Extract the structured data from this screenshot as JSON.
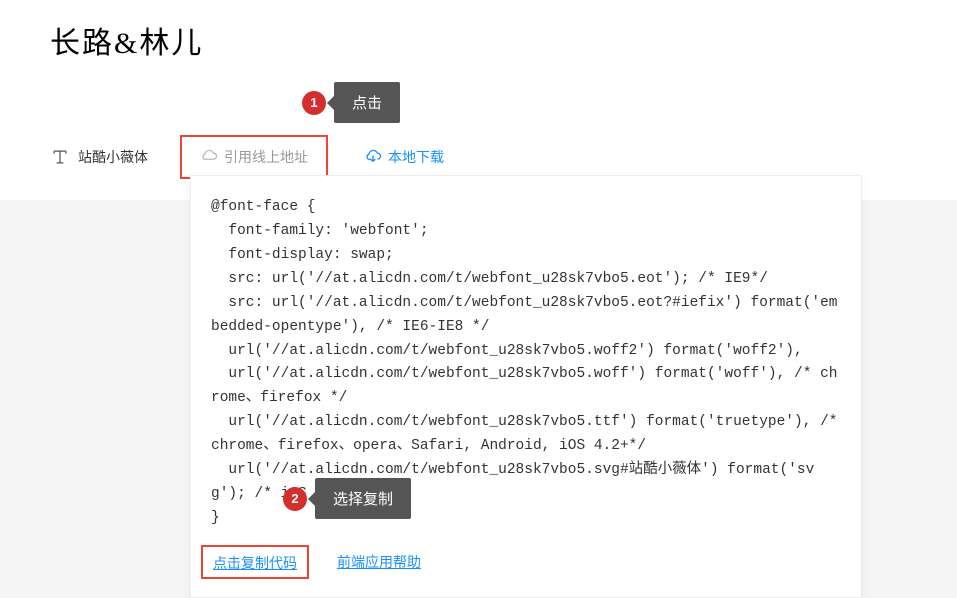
{
  "title": "长路&林儿",
  "fontLabel": "站酷小薇体",
  "tabs": {
    "online": "引用线上地址",
    "download": "本地下载"
  },
  "callouts": {
    "c1": {
      "num": "1",
      "text": "点击"
    },
    "c2": {
      "num": "2",
      "text": "选择复制"
    }
  },
  "code": "@font-face {\n  font-family: 'webfont';\n  font-display: swap;\n  src: url('//at.alicdn.com/t/webfont_u28sk7vbo5.eot'); /* IE9*/\n  src: url('//at.alicdn.com/t/webfont_u28sk7vbo5.eot?#iefix') format('embedded-opentype'), /* IE6-IE8 */\n  url('//at.alicdn.com/t/webfont_u28sk7vbo5.woff2') format('woff2'),\n  url('//at.alicdn.com/t/webfont_u28sk7vbo5.woff') format('woff'), /* chrome、firefox */\n  url('//at.alicdn.com/t/webfont_u28sk7vbo5.ttf') format('truetype'), /* chrome、firefox、opera、Safari, Android, iOS 4.2+*/\n  url('//at.alicdn.com/t/webfont_u28sk7vbo5.svg#站酷小薇体') format('svg'); /* iOS 4.1- */\n}",
  "actions": {
    "copy": "点击复制代码",
    "help": "前端应用帮助"
  }
}
